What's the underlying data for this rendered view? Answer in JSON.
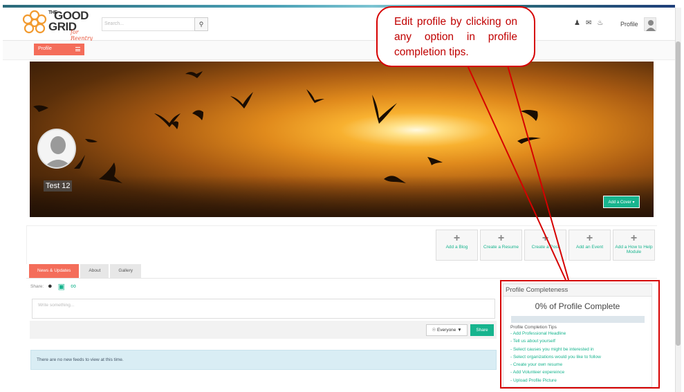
{
  "header": {
    "logo": {
      "line1": "GOOD",
      "the": "THE",
      "line2": "GRID",
      "sub": "for Reentry"
    },
    "search": {
      "placeholder": "Search..."
    },
    "profile_label": "Profile"
  },
  "subnav": {
    "profile_button": "Profile"
  },
  "cover": {
    "user_name": "Test 12",
    "add_cover_label": "Add a Cover ▾"
  },
  "actions": [
    {
      "label": "Add a Blog"
    },
    {
      "label": "Create a Resume"
    },
    {
      "label": "Create a Post"
    },
    {
      "label": "Add an Event"
    },
    {
      "label": "Add a How to Help Module"
    }
  ],
  "tabs": [
    {
      "label": "News & Updates",
      "active": true
    },
    {
      "label": "About",
      "active": false
    },
    {
      "label": "Gallery",
      "active": false
    }
  ],
  "share": {
    "label": "Share:",
    "composer_placeholder": "Write something...",
    "audience": "Everyone",
    "button": "Share"
  },
  "feed": {
    "empty_message": "There are no new feeds to view at this time."
  },
  "profile_completeness": {
    "title": "Profile Completeness",
    "percent_label": "0% of Profile Complete",
    "percent_value": 0,
    "tips_title": "Profile Completion Tips",
    "tips": [
      "- Add Professional Headline",
      "- Tell us about yourself",
      "- Select causes you might be interested in",
      "- Select organizations would you like to follow",
      "- Create your own resume",
      "- Add Volunteer expereince",
      "- Upload Profile Picture"
    ]
  },
  "annotation": {
    "callout_text": "Edit profile by clicking on any option in profile completion tips.",
    "color": "#d60000"
  },
  "colors": {
    "accent": "#f46d5a",
    "teal": "#17b48e"
  }
}
